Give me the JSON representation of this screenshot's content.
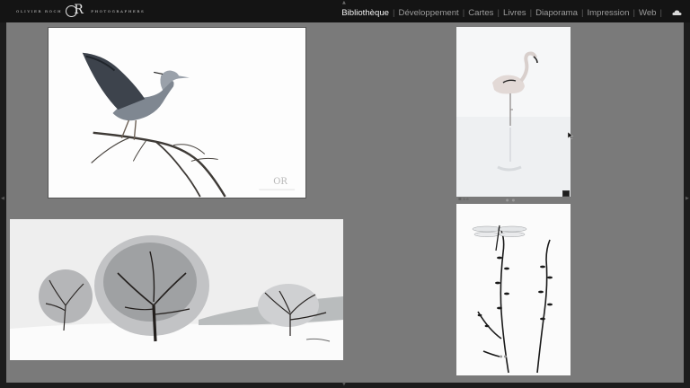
{
  "header": {
    "logo": {
      "left_text": "OLIVIER ROCH",
      "right_text": "PHOTOGRAPHERS",
      "monogram": "OR"
    },
    "modules": [
      {
        "label": "Bibliothèque",
        "active": true
      },
      {
        "label": "Développement",
        "active": false
      },
      {
        "label": "Cartes",
        "active": false
      },
      {
        "label": "Livres",
        "active": false
      },
      {
        "label": "Diaporama",
        "active": false
      },
      {
        "label": "Impression",
        "active": false
      },
      {
        "label": "Web",
        "active": false
      }
    ],
    "cloud_icon": "cloud-icon"
  },
  "gallery": {
    "photos": [
      {
        "subject": "heron",
        "signature": "OR"
      },
      {
        "subject": "flamingo"
      },
      {
        "subject": "snow-trees"
      },
      {
        "subject": "dragonfly"
      }
    ],
    "flamingo_strip": {
      "meta": "☰ ☆☆",
      "dots": "● ●"
    },
    "dragonfly_dots": "● ●"
  },
  "colors": {
    "background": "#7a7a7a",
    "topbar": "#141414",
    "active_module": "#f2f2f2",
    "inactive_module": "#9c9c9c"
  }
}
